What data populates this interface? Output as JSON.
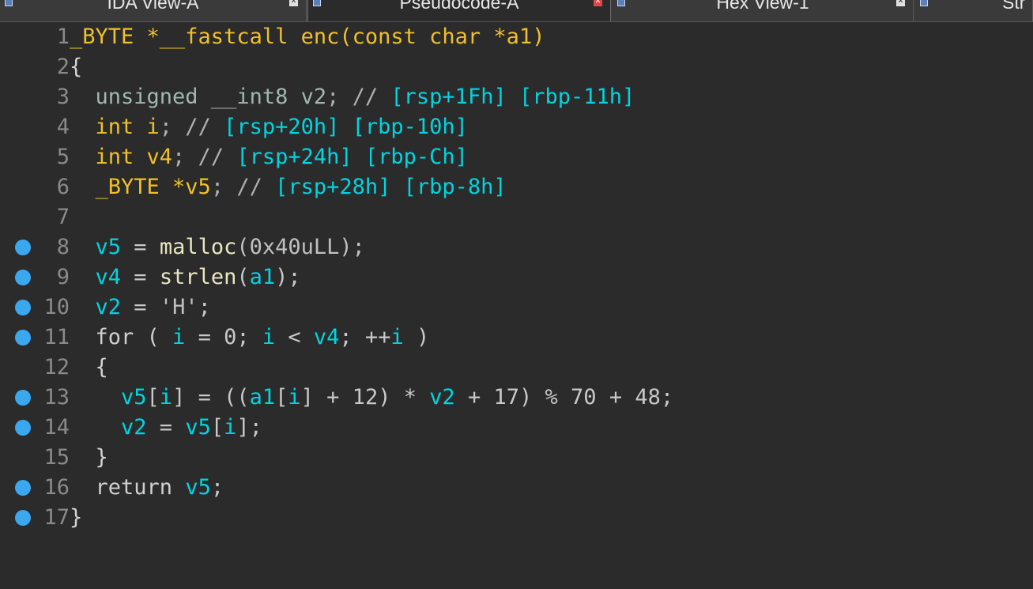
{
  "tabs": [
    {
      "label": "IDA View-A",
      "icon": "disassembly-view-icon",
      "active": false
    },
    {
      "label": "Pseudocode-A",
      "icon": "pseudocode-view-icon",
      "active": true
    },
    {
      "label": "Hex View-1",
      "icon": "hex-view-icon",
      "active": false
    },
    {
      "label": "Str",
      "icon": "strings-view-icon",
      "active": false
    }
  ],
  "tab_close_glyph": "✕",
  "colors": {
    "background": "#2b2b2b",
    "keyword": "#f0c02a",
    "variable": "#00d4e0",
    "breakpoint": "#3aa8ee",
    "line_number": "#8a8a8a"
  },
  "code": [
    {
      "n": "1",
      "bp": false,
      "tokens": [
        {
          "t": "_BYTE *__fastcall enc(const char *a1)",
          "c": "kw"
        }
      ]
    },
    {
      "n": "2",
      "bp": false,
      "tokens": [
        {
          "t": "{",
          "c": "plain"
        }
      ]
    },
    {
      "n": "3",
      "bp": false,
      "tokens": [
        {
          "t": "  unsigned __int8 ",
          "c": "type"
        },
        {
          "t": "v2",
          "c": "type"
        },
        {
          "t": "; // ",
          "c": "com"
        },
        {
          "t": "[rsp+1Fh] [rbp-11h]",
          "c": "var"
        }
      ]
    },
    {
      "n": "4",
      "bp": false,
      "tokens": [
        {
          "t": "  int i",
          "c": "kw"
        },
        {
          "t": "; // ",
          "c": "com"
        },
        {
          "t": "[rsp+20h] [rbp-10h]",
          "c": "var"
        }
      ]
    },
    {
      "n": "5",
      "bp": false,
      "tokens": [
        {
          "t": "  int v4",
          "c": "kw"
        },
        {
          "t": "; // ",
          "c": "com"
        },
        {
          "t": "[rsp+24h] [rbp-Ch]",
          "c": "var"
        }
      ]
    },
    {
      "n": "6",
      "bp": false,
      "tokens": [
        {
          "t": "  _BYTE *v5",
          "c": "kw"
        },
        {
          "t": "; // ",
          "c": "com"
        },
        {
          "t": "[rsp+28h] [rbp-8h]",
          "c": "var"
        }
      ]
    },
    {
      "n": "7",
      "bp": false,
      "tokens": []
    },
    {
      "n": "8",
      "bp": true,
      "tokens": [
        {
          "t": "  ",
          "c": "plain"
        },
        {
          "t": "v5",
          "c": "var"
        },
        {
          "t": " = ",
          "c": "op"
        },
        {
          "t": "malloc",
          "c": "fn"
        },
        {
          "t": "(0x40uLL);",
          "c": "num"
        }
      ]
    },
    {
      "n": "9",
      "bp": true,
      "tokens": [
        {
          "t": "  ",
          "c": "plain"
        },
        {
          "t": "v4",
          "c": "var"
        },
        {
          "t": " = ",
          "c": "op"
        },
        {
          "t": "strlen",
          "c": "fn"
        },
        {
          "t": "(",
          "c": "op"
        },
        {
          "t": "a1",
          "c": "var"
        },
        {
          "t": ");",
          "c": "op"
        }
      ]
    },
    {
      "n": "10",
      "bp": true,
      "tokens": [
        {
          "t": "  ",
          "c": "plain"
        },
        {
          "t": "v2",
          "c": "var"
        },
        {
          "t": " = ",
          "c": "op"
        },
        {
          "t": "'H'",
          "c": "str"
        },
        {
          "t": ";",
          "c": "op"
        }
      ]
    },
    {
      "n": "11",
      "bp": true,
      "tokens": [
        {
          "t": "  for ( ",
          "c": "ret"
        },
        {
          "t": "i",
          "c": "var"
        },
        {
          "t": " = 0; ",
          "c": "op"
        },
        {
          "t": "i",
          "c": "var"
        },
        {
          "t": " < ",
          "c": "op"
        },
        {
          "t": "v4",
          "c": "var"
        },
        {
          "t": "; ++",
          "c": "op"
        },
        {
          "t": "i",
          "c": "var"
        },
        {
          "t": " )",
          "c": "op"
        }
      ]
    },
    {
      "n": "12",
      "bp": false,
      "tokens": [
        {
          "t": "  {",
          "c": "plain"
        }
      ]
    },
    {
      "n": "13",
      "bp": true,
      "tokens": [
        {
          "t": "    ",
          "c": "plain"
        },
        {
          "t": "v5",
          "c": "var"
        },
        {
          "t": "[",
          "c": "op"
        },
        {
          "t": "i",
          "c": "var"
        },
        {
          "t": "] = ((",
          "c": "op"
        },
        {
          "t": "a1",
          "c": "var"
        },
        {
          "t": "[",
          "c": "op"
        },
        {
          "t": "i",
          "c": "var"
        },
        {
          "t": "] + 12) * ",
          "c": "op"
        },
        {
          "t": "v2",
          "c": "var"
        },
        {
          "t": " + 17) % 70 + 48;",
          "c": "op"
        }
      ]
    },
    {
      "n": "14",
      "bp": true,
      "tokens": [
        {
          "t": "    ",
          "c": "plain"
        },
        {
          "t": "v2",
          "c": "var"
        },
        {
          "t": " = ",
          "c": "op"
        },
        {
          "t": "v5",
          "c": "var"
        },
        {
          "t": "[",
          "c": "op"
        },
        {
          "t": "i",
          "c": "var"
        },
        {
          "t": "];",
          "c": "op"
        }
      ]
    },
    {
      "n": "15",
      "bp": false,
      "tokens": [
        {
          "t": "  }",
          "c": "plain"
        }
      ]
    },
    {
      "n": "16",
      "bp": true,
      "tokens": [
        {
          "t": "  return ",
          "c": "ret"
        },
        {
          "t": "v5",
          "c": "var"
        },
        {
          "t": ";",
          "c": "op"
        }
      ]
    },
    {
      "n": "17",
      "bp": true,
      "tokens": [
        {
          "t": "}",
          "c": "plain"
        }
      ]
    }
  ]
}
